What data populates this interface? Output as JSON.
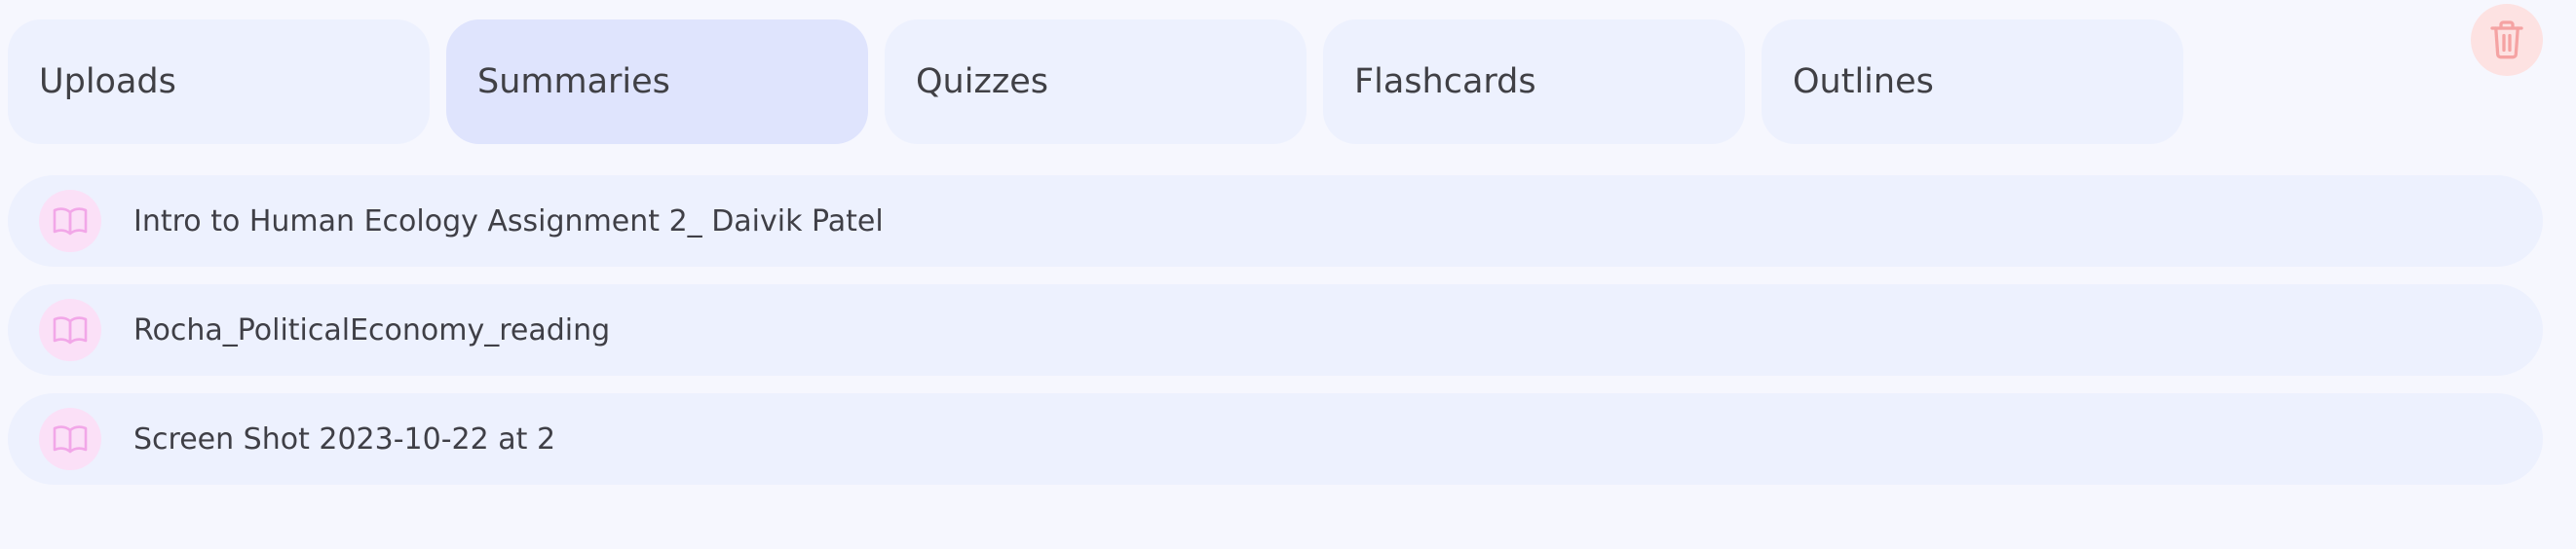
{
  "tabs": [
    {
      "label": "Uploads",
      "active": false
    },
    {
      "label": "Summaries",
      "active": true
    },
    {
      "label": "Quizzes",
      "active": false
    },
    {
      "label": "Flashcards",
      "active": false
    },
    {
      "label": "Outlines",
      "active": false
    }
  ],
  "actions": {
    "delete_icon": "trash-icon"
  },
  "documents": [
    {
      "title": "Intro to Human Ecology Assignment 2_ Daivik Patel",
      "icon": "book-icon"
    },
    {
      "title": "Rocha_PoliticalEconomy_reading",
      "icon": "book-icon"
    },
    {
      "title": "Screen Shot 2023-10-22 at 2",
      "icon": "book-icon"
    }
  ],
  "colors": {
    "page_background": "#f6f7fe",
    "tab_background": "#edf1fe",
    "tab_active_background": "#dfe4fd",
    "delete_icon": "#f5a3a3",
    "delete_background": "#fde2e2",
    "book_icon": "#f2a7e8",
    "book_icon_background": "#fbe0f7"
  }
}
